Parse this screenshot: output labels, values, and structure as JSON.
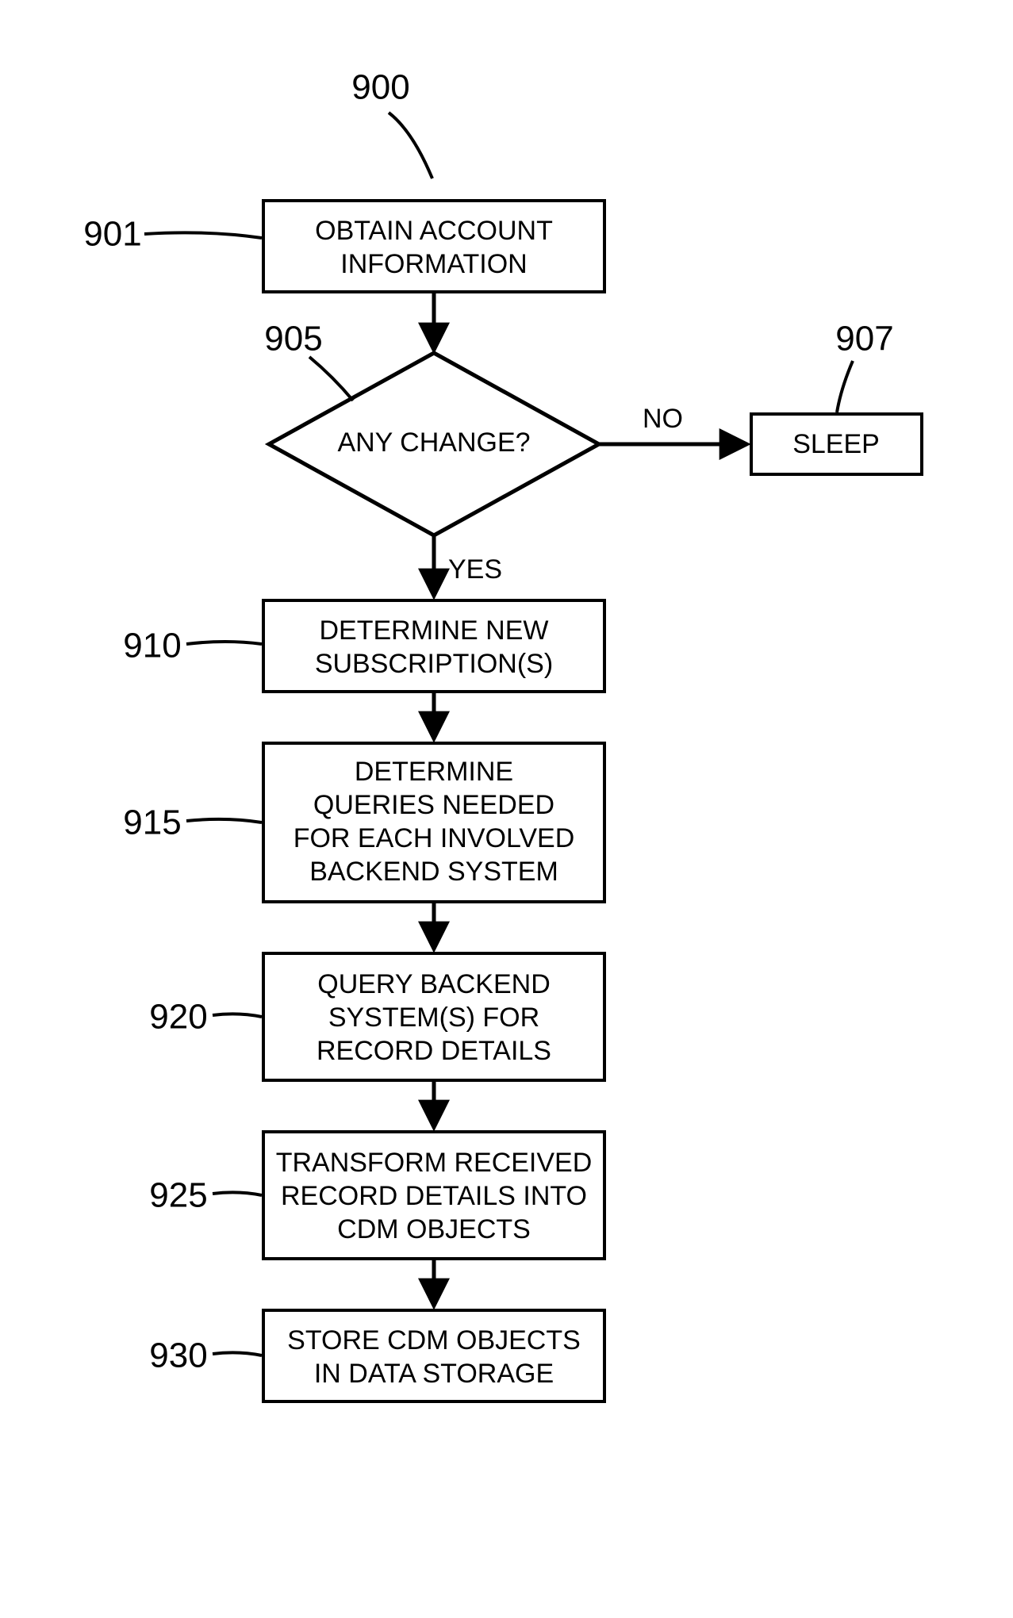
{
  "figure_ref": "900",
  "nodes": {
    "n901": {
      "ref": "901",
      "text": "OBTAIN ACCOUNT INFORMATION"
    },
    "n905": {
      "ref": "905",
      "text": "ANY CHANGE?"
    },
    "n907": {
      "ref": "907",
      "text": "SLEEP"
    },
    "n910": {
      "ref": "910",
      "text": "DETERMINE NEW SUBSCRIPTION(S)"
    },
    "n915": {
      "ref": "915",
      "text": "DETERMINE QUERIES NEEDED FOR EACH INVOLVED BACKEND SYSTEM"
    },
    "n920": {
      "ref": "920",
      "text": "QUERY BACKEND SYSTEM(S) FOR RECORD DETAILS"
    },
    "n925": {
      "ref": "925",
      "text": "TRANSFORM RECEIVED RECORD DETAILS INTO CDM OBJECTS"
    },
    "n930": {
      "ref": "930",
      "text": "STORE CDM OBJECTS IN DATA STORAGE"
    }
  },
  "edges": {
    "no": "NO",
    "yes": "YES"
  }
}
